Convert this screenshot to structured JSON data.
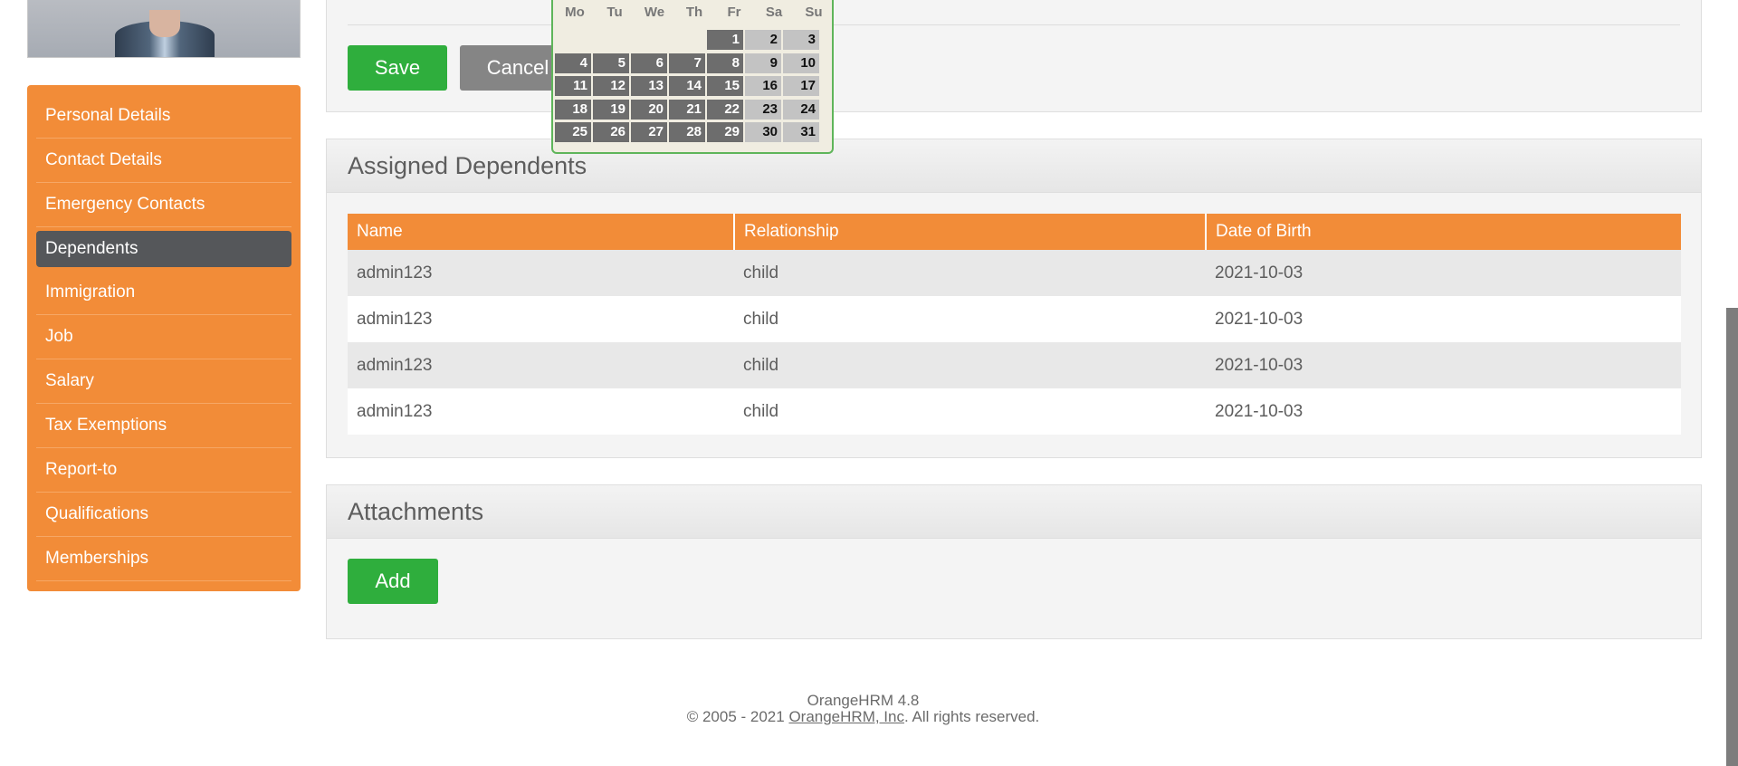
{
  "sidebar": {
    "items": [
      {
        "label": "Personal Details"
      },
      {
        "label": "Contact Details"
      },
      {
        "label": "Emergency Contacts"
      },
      {
        "label": "Dependents"
      },
      {
        "label": "Immigration"
      },
      {
        "label": "Job"
      },
      {
        "label": "Salary"
      },
      {
        "label": "Tax Exemptions"
      },
      {
        "label": "Report-to"
      },
      {
        "label": "Qualifications"
      },
      {
        "label": "Memberships"
      }
    ],
    "active": "Dependents"
  },
  "form": {
    "save_label": "Save",
    "cancel_label": "Cancel"
  },
  "calendar": {
    "weekdays": [
      "Mo",
      "Tu",
      "We",
      "Th",
      "Fr",
      "Sa",
      "Su"
    ],
    "weeks": [
      [
        "",
        "",
        "",
        "",
        "1",
        "2",
        "3"
      ],
      [
        "4",
        "5",
        "6",
        "7",
        "8",
        "9",
        "10"
      ],
      [
        "11",
        "12",
        "13",
        "14",
        "15",
        "16",
        "17"
      ],
      [
        "18",
        "19",
        "20",
        "21",
        "22",
        "23",
        "24"
      ],
      [
        "25",
        "26",
        "27",
        "28",
        "29",
        "30",
        "31"
      ]
    ]
  },
  "dependents": {
    "title": "Assigned Dependents",
    "columns": [
      "Name",
      "Relationship",
      "Date of Birth"
    ],
    "rows": [
      [
        "admin123",
        "child",
        "2021-10-03"
      ],
      [
        "admin123",
        "child",
        "2021-10-03"
      ],
      [
        "admin123",
        "child",
        "2021-10-03"
      ],
      [
        "admin123",
        "child",
        "2021-10-03"
      ]
    ]
  },
  "attachments": {
    "title": "Attachments",
    "add_label": "Add"
  },
  "footer": {
    "version": "OrangeHRM 4.8",
    "copyright_prefix": "© 2005 - 2021 ",
    "company_link": "OrangeHRM, Inc",
    "copyright_suffix": ". All rights reserved."
  },
  "colors": {
    "accent": "#f28c38",
    "success": "#2fae3d",
    "active_nav": "#55575a"
  }
}
